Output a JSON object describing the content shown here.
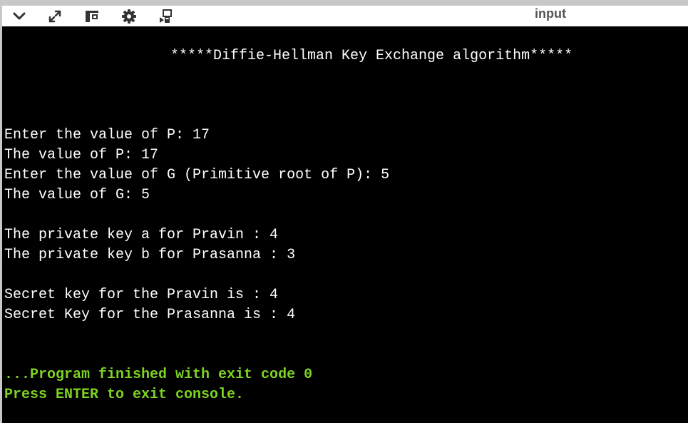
{
  "toolbar": {
    "tab_label": "input",
    "icons": [
      "chevron-down-icon",
      "expand-icon",
      "layout-icon",
      "gear-icon",
      "share-icon"
    ]
  },
  "console": {
    "header": "*****Diffie-Hellman Key Exchange algorithm*****",
    "lines": [
      "Enter the value of P: 17",
      "The value of P: 17",
      "Enter the value of G (Primitive root of P): 5",
      "The value of G: 5",
      "The private key a for Pravin : 4",
      "The private key b for Prasanna : 3",
      "Secret key for the Pravin is : 4",
      "Secret Key for the Prasanna is : 4"
    ],
    "status_lines": [
      "...Program finished with exit code 0",
      "Press ENTER to exit console."
    ]
  },
  "colors": {
    "console_background": "#000000",
    "console_text": "#ffffff",
    "status_text": "#7ed321",
    "toolbar_background": "#ffffff",
    "icon_color": "#333333"
  }
}
